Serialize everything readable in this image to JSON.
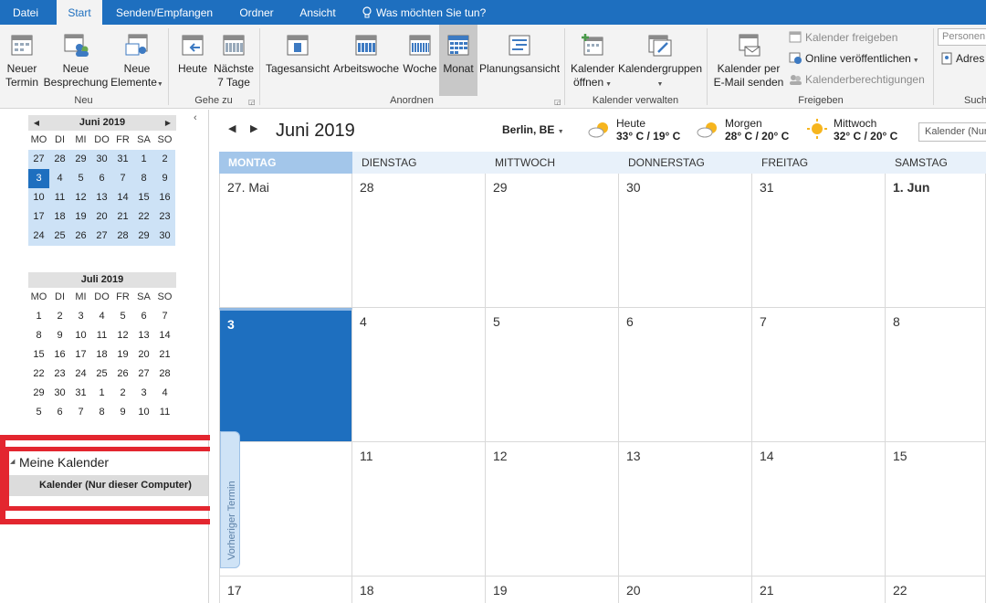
{
  "tabs": [
    {
      "label": "Datei",
      "active": false
    },
    {
      "label": "Start",
      "active": true
    },
    {
      "label": "Senden/Empfangen",
      "active": false
    },
    {
      "label": "Ordner",
      "active": false
    },
    {
      "label": "Ansicht",
      "active": false
    }
  ],
  "tell_me": "Was möchten Sie tun?",
  "ribbon": {
    "neu": {
      "label": "Neu",
      "neuer_termin": [
        "Neuer",
        "Termin"
      ],
      "neue_besprechung": [
        "Neue",
        "Besprechung"
      ],
      "neue_elemente": [
        "Neue",
        "Elemente"
      ]
    },
    "gehe_zu": {
      "label": "Gehe zu",
      "heute": "Heute",
      "naechste": [
        "Nächste",
        "7 Tage"
      ]
    },
    "anordnen": {
      "label": "Anordnen",
      "tagesansicht": "Tagesansicht",
      "arbeitswoche": "Arbeitswoche",
      "woche": "Woche",
      "monat": "Monat",
      "planungsansicht": "Planungsansicht"
    },
    "kalender_verwalten": {
      "label": "Kalender verwalten",
      "kalender_oeffnen": [
        "Kalender",
        "öffnen"
      ],
      "kalendergruppen": "Kalendergruppen"
    },
    "freigeben": {
      "label": "Freigeben",
      "email_senden": [
        "Kalender per",
        "E-Mail senden"
      ],
      "kalender_freigeben": "Kalender freigeben",
      "online": "Online veröffentlichen",
      "berechtigungen": "Kalenderberechtigungen"
    },
    "suchen": {
      "label": "Such",
      "personen_placeholder": "Personen",
      "adress": "Adres"
    }
  },
  "mini_june": {
    "title": "Juni 2019",
    "dow": [
      "MO",
      "DI",
      "MI",
      "DO",
      "FR",
      "SA",
      "SO"
    ],
    "days": [
      "27",
      "28",
      "29",
      "30",
      "31",
      "1",
      "2",
      "3",
      "4",
      "5",
      "6",
      "7",
      "8",
      "9",
      "10",
      "11",
      "12",
      "13",
      "14",
      "15",
      "16",
      "17",
      "18",
      "19",
      "20",
      "21",
      "22",
      "23",
      "24",
      "25",
      "26",
      "27",
      "28",
      "29",
      "30"
    ],
    "today": "3"
  },
  "mini_july": {
    "title": "Juli 2019",
    "dow": [
      "MO",
      "DI",
      "MI",
      "DO",
      "FR",
      "SA",
      "SO"
    ],
    "days": [
      "1",
      "2",
      "3",
      "4",
      "5",
      "6",
      "7",
      "8",
      "9",
      "10",
      "11",
      "12",
      "13",
      "14",
      "15",
      "16",
      "17",
      "18",
      "19",
      "20",
      "21",
      "22",
      "23",
      "24",
      "25",
      "26",
      "27",
      "28",
      "29",
      "30",
      "31",
      "1",
      "2",
      "3",
      "4",
      "5",
      "6",
      "7",
      "8",
      "9",
      "10",
      "11"
    ]
  },
  "my_calendars": {
    "title": "Meine Kalender",
    "items": [
      "Kalender (Nur dieser Computer)"
    ]
  },
  "calendar": {
    "month_title": "Juni 2019",
    "location": "Berlin, BE",
    "weather": [
      {
        "day": "Heute",
        "temp": "33° C / 19° C"
      },
      {
        "day": "Morgen",
        "temp": "28° C / 20° C"
      },
      {
        "day": "Mittwoch",
        "temp": "32° C / 20° C"
      }
    ],
    "search_placeholder": "Kalender (Nur",
    "weekdays": [
      "MONTAG",
      "DIENSTAG",
      "MITTWOCH",
      "DONNERSTAG",
      "FREITAG",
      "SAMSTAG"
    ],
    "rows": [
      [
        "27. Mai",
        "28",
        "29",
        "30",
        "31",
        "1. Jun"
      ],
      [
        "3",
        "4",
        "5",
        "6",
        "7",
        "8"
      ],
      [
        "",
        "11",
        "12",
        "13",
        "14",
        "15"
      ],
      [
        "17",
        "18",
        "19",
        "20",
        "21",
        "22"
      ]
    ],
    "prev_appointment": "Vorheriger Termin",
    "colors": {
      "accent": "#1e6fbf",
      "highlight": "#e3262f"
    }
  }
}
